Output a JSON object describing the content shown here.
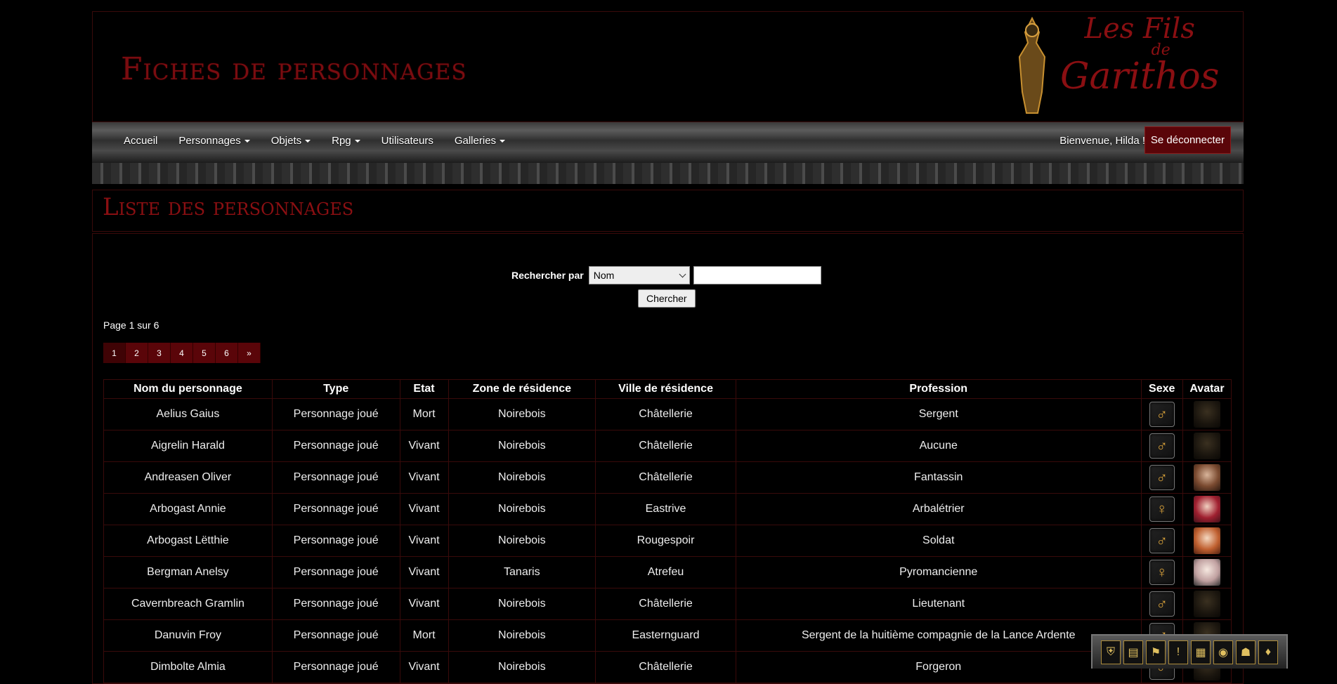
{
  "header": {
    "title": "Fiches de personnages",
    "logo": {
      "line1": "Les Fils",
      "line2": "de",
      "line3": "Garithos"
    }
  },
  "nav": {
    "items": [
      {
        "label": "Accueil",
        "dropdown": false
      },
      {
        "label": "Personnages",
        "dropdown": true
      },
      {
        "label": "Objets",
        "dropdown": true
      },
      {
        "label": "Rpg",
        "dropdown": true
      },
      {
        "label": "Utilisateurs",
        "dropdown": false
      },
      {
        "label": "Galleries",
        "dropdown": true
      }
    ],
    "welcome": "Bienvenue, Hilda !",
    "logout": "Se déconnecter"
  },
  "section": {
    "title": "Liste des personnages"
  },
  "search": {
    "label": "Rechercher par",
    "selected": "Nom",
    "input_value": "",
    "button": "Chercher"
  },
  "page_info": "Page 1 sur 6",
  "pagination": [
    "1",
    "2",
    "3",
    "4",
    "5",
    "6",
    "»"
  ],
  "table": {
    "headers": [
      "Nom du personnage",
      "Type",
      "Etat",
      "Zone de résidence",
      "Ville de résidence",
      "Profession",
      "Sexe",
      "Avatar"
    ],
    "rows": [
      {
        "name": "Aelius Gaius",
        "type": "Personnage joué",
        "state": "Mort",
        "zone": "Noirebois",
        "city": "Châtellerie",
        "profession": "Sergent",
        "sex": "male",
        "avatar": "default"
      },
      {
        "name": "Aigrelin Harald",
        "type": "Personnage joué",
        "state": "Vivant",
        "zone": "Noirebois",
        "city": "Châtellerie",
        "profession": "Aucune",
        "sex": "male",
        "avatar": "default"
      },
      {
        "name": "Andreasen Oliver",
        "type": "Personnage joué",
        "state": "Vivant",
        "zone": "Noirebois",
        "city": "Châtellerie",
        "profession": "Fantassin",
        "sex": "male",
        "avatar": "real"
      },
      {
        "name": "Arbogast Annie",
        "type": "Personnage joué",
        "state": "Vivant",
        "zone": "Noirebois",
        "city": "Eastrive",
        "profession": "Arbalétrier",
        "sex": "female",
        "avatar": "real2"
      },
      {
        "name": "Arbogast Lëtthie",
        "type": "Personnage joué",
        "state": "Vivant",
        "zone": "Noirebois",
        "city": "Rougespoir",
        "profession": "Soldat",
        "sex": "male",
        "avatar": "real3"
      },
      {
        "name": "Bergman Anelsy",
        "type": "Personnage joué",
        "state": "Vivant",
        "zone": "Tanaris",
        "city": "Atrefeu",
        "profession": "Pyromancienne",
        "sex": "female",
        "avatar": "real4"
      },
      {
        "name": "Cavernbreach Gramlin",
        "type": "Personnage joué",
        "state": "Vivant",
        "zone": "Noirebois",
        "city": "Châtellerie",
        "profession": "Lieutenant",
        "sex": "male",
        "avatar": "default"
      },
      {
        "name": "Danuvin Froy",
        "type": "Personnage joué",
        "state": "Mort",
        "zone": "Noirebois",
        "city": "Easternguard",
        "profession": "Sergent de la huitième compagnie de la Lance Ardente",
        "sex": "male",
        "avatar": "default"
      },
      {
        "name": "Dimbolte Almia",
        "type": "Personnage joué",
        "state": "Vivant",
        "zone": "Noirebois",
        "city": "Châtellerie",
        "profession": "Forgeron",
        "sex": "male",
        "avatar": "default"
      }
    ]
  },
  "toolbar": {
    "icons": [
      "shield-icon",
      "scroll-icon",
      "banner-icon",
      "alert-icon",
      "map-icon",
      "orb-icon",
      "helmet-icon",
      "blood-icon"
    ],
    "glyphs": [
      "⛨",
      "▤",
      "⚑",
      "!",
      "▦",
      "◉",
      "☗",
      "♦"
    ]
  }
}
